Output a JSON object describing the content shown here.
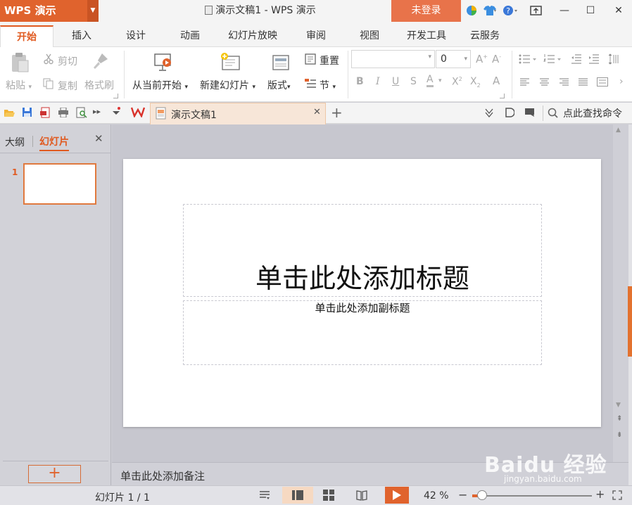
{
  "app": {
    "logo": "WPS 演示",
    "doc_title": "演示文稿1 - WPS 演示",
    "login_button": "未登录"
  },
  "tabs": [
    "开始",
    "插入",
    "设计",
    "动画",
    "幻灯片放映",
    "审阅",
    "视图",
    "开发工具",
    "云服务"
  ],
  "ribbon": {
    "paste": "粘贴",
    "cut": "剪切",
    "copy": "复制",
    "format_painter": "格式刷",
    "play_from_current": "从当前开始",
    "new_slide": "新建幻灯片",
    "layout": "版式",
    "reset": "重置",
    "section": "节",
    "font_size_value": "0",
    "font_name_value": ""
  },
  "quickbar": {
    "doc_tab": "演示文稿1",
    "search": "点此查找命令"
  },
  "panel": {
    "tab_outline": "大纲",
    "tab_slides": "幻灯片",
    "slide_number": "1",
    "add_slide": "+"
  },
  "slide": {
    "title_placeholder": "单击此处添加标题",
    "subtitle_placeholder": "单击此处添加副标题"
  },
  "notes": {
    "placeholder": "单击此处添加备注"
  },
  "status": {
    "slide_counter": "幻灯片 1 / 1",
    "zoom": "42 %",
    "zoom_level": 0.42
  },
  "colors": {
    "accent": "#e0632d",
    "login": "#e8734a"
  }
}
